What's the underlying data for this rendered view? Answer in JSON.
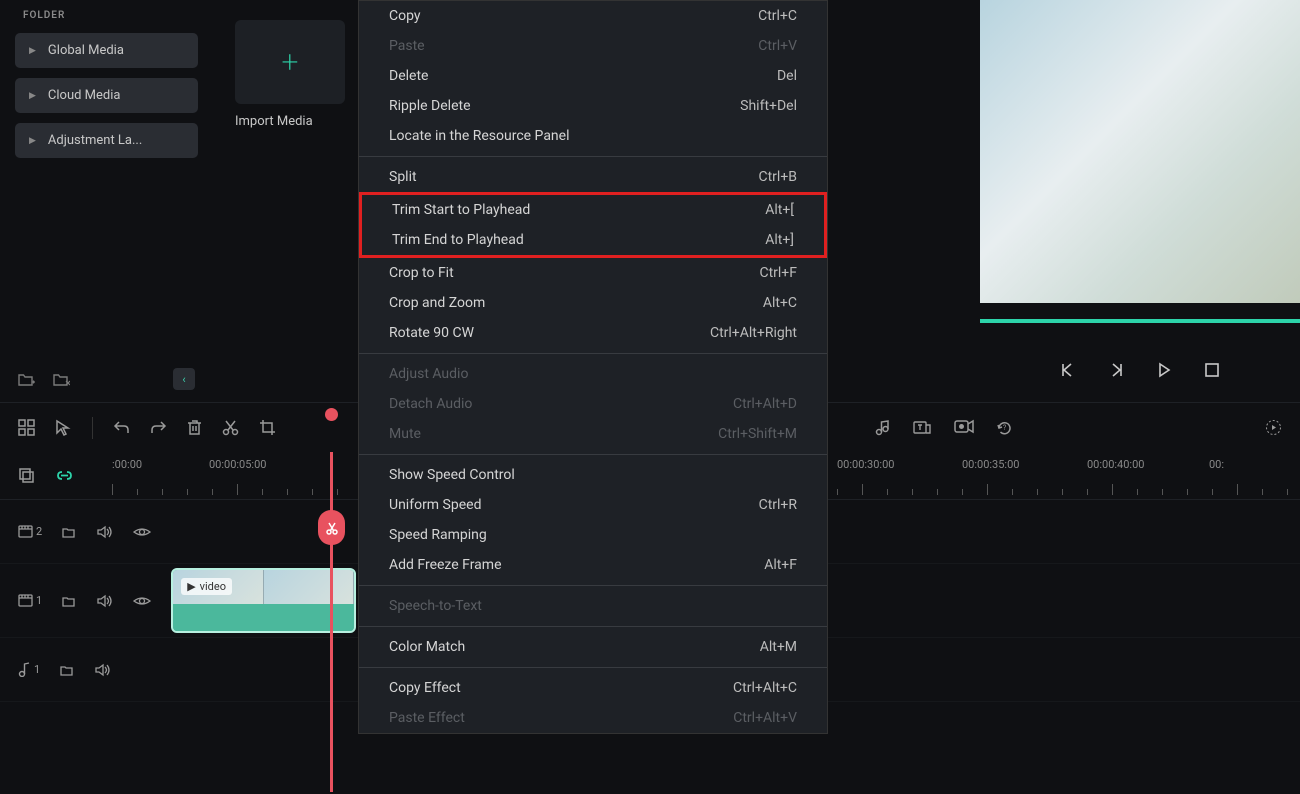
{
  "sidebar": {
    "folder_label": "FOLDER",
    "items": [
      "Global Media",
      "Cloud Media",
      "Adjustment La..."
    ]
  },
  "media": {
    "import_label": "Import Media"
  },
  "context_menu": {
    "groups": [
      [
        {
          "label": "Copy",
          "shortcut": "Ctrl+C",
          "disabled": false
        },
        {
          "label": "Paste",
          "shortcut": "Ctrl+V",
          "disabled": true
        },
        {
          "label": "Delete",
          "shortcut": "Del",
          "disabled": false
        },
        {
          "label": "Ripple Delete",
          "shortcut": "Shift+Del",
          "disabled": false
        },
        {
          "label": "Locate in the Resource Panel",
          "shortcut": "",
          "disabled": false
        }
      ],
      [
        {
          "label": "Split",
          "shortcut": "Ctrl+B",
          "disabled": false
        },
        {
          "label": "Trim Start to Playhead",
          "shortcut": "Alt+[",
          "disabled": false,
          "highlighted": true
        },
        {
          "label": "Trim End to Playhead",
          "shortcut": "Alt+]",
          "disabled": false,
          "highlighted": true
        },
        {
          "label": "Crop to Fit",
          "shortcut": "Ctrl+F",
          "disabled": false
        },
        {
          "label": "Crop and Zoom",
          "shortcut": "Alt+C",
          "disabled": false
        },
        {
          "label": "Rotate 90 CW",
          "shortcut": "Ctrl+Alt+Right",
          "disabled": false
        }
      ],
      [
        {
          "label": "Adjust Audio",
          "shortcut": "",
          "disabled": true
        },
        {
          "label": "Detach Audio",
          "shortcut": "Ctrl+Alt+D",
          "disabled": true
        },
        {
          "label": "Mute",
          "shortcut": "Ctrl+Shift+M",
          "disabled": true
        }
      ],
      [
        {
          "label": "Show Speed Control",
          "shortcut": "",
          "disabled": false
        },
        {
          "label": "Uniform Speed",
          "shortcut": "Ctrl+R",
          "disabled": false
        },
        {
          "label": "Speed Ramping",
          "shortcut": "",
          "disabled": false
        },
        {
          "label": "Add Freeze Frame",
          "shortcut": "Alt+F",
          "disabled": false
        }
      ],
      [
        {
          "label": "Speech-to-Text",
          "shortcut": "",
          "disabled": true
        }
      ],
      [
        {
          "label": "Color Match",
          "shortcut": "Alt+M",
          "disabled": false
        }
      ],
      [
        {
          "label": "Copy Effect",
          "shortcut": "Ctrl+Alt+C",
          "disabled": false
        },
        {
          "label": "Paste Effect",
          "shortcut": "Ctrl+Alt+V",
          "disabled": true
        }
      ]
    ]
  },
  "timeline": {
    "ruler": [
      ":00:00",
      "00:00:05:00",
      "00:00:30:00",
      "00:00:35:00",
      "00:00:40:00",
      "00:"
    ],
    "ruler_positions": [
      18,
      115,
      743,
      868,
      993,
      1115
    ],
    "clip_label": "video",
    "tracks": [
      {
        "icon": "video",
        "num": "2"
      },
      {
        "icon": "video",
        "num": "1"
      },
      {
        "icon": "audio",
        "num": "1"
      }
    ]
  }
}
